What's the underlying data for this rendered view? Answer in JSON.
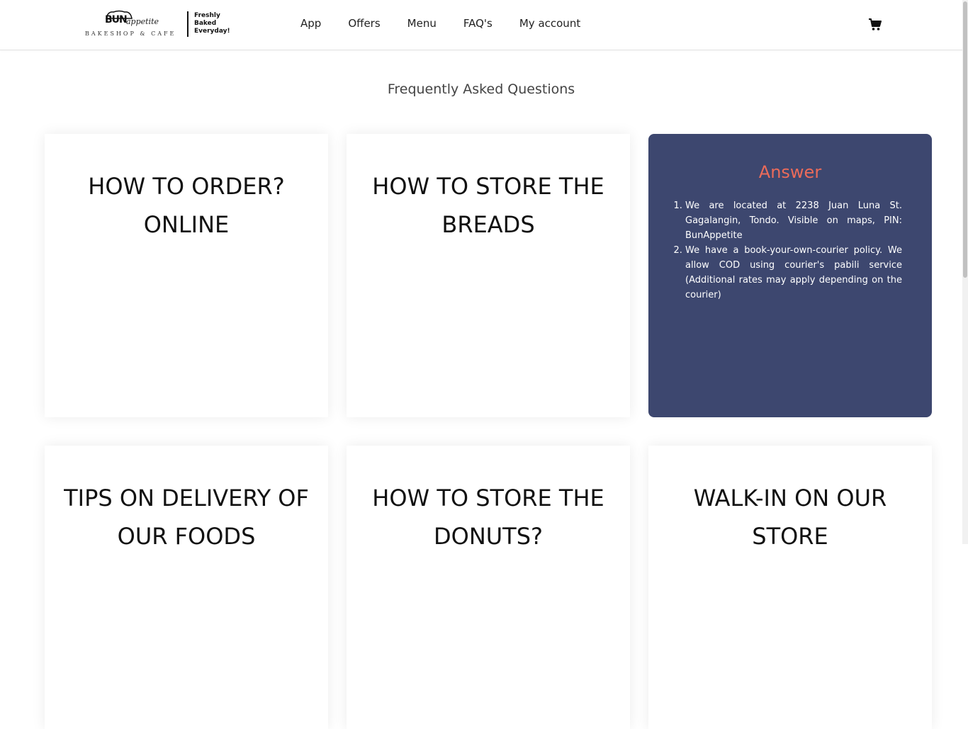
{
  "brand": {
    "name": "BUN",
    "script": "appetite",
    "subtitle": "BAKESHOP & CAFE",
    "tagline": [
      "Freshly",
      "Baked",
      "Everyday!"
    ]
  },
  "nav": {
    "items": [
      {
        "label": "App"
      },
      {
        "label": "Offers"
      },
      {
        "label": "Menu"
      },
      {
        "label": "FAQ's"
      },
      {
        "label": "My account"
      }
    ],
    "cart_icon": "shopping-cart-icon"
  },
  "page": {
    "title": "Frequently Asked Questions"
  },
  "faq_cards": [
    {
      "title": "HOW TO ORDER? ONLINE"
    },
    {
      "title": "HOW TO STORE THE BREADS"
    },
    {
      "title": "TIPS ON DELIVERY OF OUR FOODS"
    },
    {
      "title": "HOW TO STORE THE DONUTS?"
    },
    {
      "title": "WALK-IN ON OUR STORE"
    }
  ],
  "answer_card": {
    "title": "Answer",
    "items": [
      "We are located at 2238 Juan Luna St. Gagalangin, Tondo. Visible on maps, PIN: BunAppetite",
      "We have a book-your-own-courier policy. We allow COD using courier's pabili service (Additional rates may apply depending on the courier)"
    ]
  },
  "colors": {
    "answer_bg": "#3d476f",
    "answer_title": "#ec6b5a",
    "text": "#111111"
  }
}
